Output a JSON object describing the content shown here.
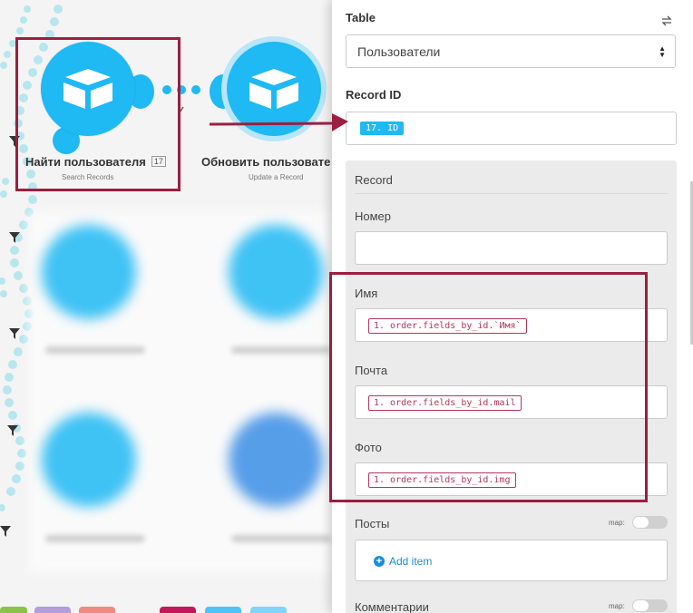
{
  "modules": {
    "find_user": {
      "title": "Найти пользователя",
      "badge": "17",
      "subtitle": "Search Records"
    },
    "update_user": {
      "title": "Обновить пользовате",
      "subtitle": "Update a Record"
    }
  },
  "panel": {
    "table_label": "Table",
    "table_value": "Пользователи",
    "record_id_label": "Record ID",
    "record_id_value": "17. ID",
    "record_section_label": "Record",
    "fields": {
      "nomer_label": "Номер",
      "imya_label": "Имя",
      "imya_value": "1. order.fields_by_id.`Имя`",
      "pochta_label": "Почта",
      "pochta_value": "1. order.fields_by_id.mail",
      "foto_label": "Фото",
      "foto_value": "1. order.fields_by_id.img",
      "posty_label": "Посты",
      "posty_map_label": "map:",
      "add_item_label": "Add item",
      "kommentarii_label": "Комментарии",
      "kommentarii_map_label": "map:"
    }
  },
  "colors": {
    "module_blue": "#1fb9f4",
    "highlight_red": "#9b1f3f",
    "link_blue": "#1a8fd6",
    "pill_red": "#b5375b"
  },
  "icons": {
    "module_icon": "airtable-box-icon",
    "filter": "filter-icon",
    "swap": "swap-icon"
  }
}
